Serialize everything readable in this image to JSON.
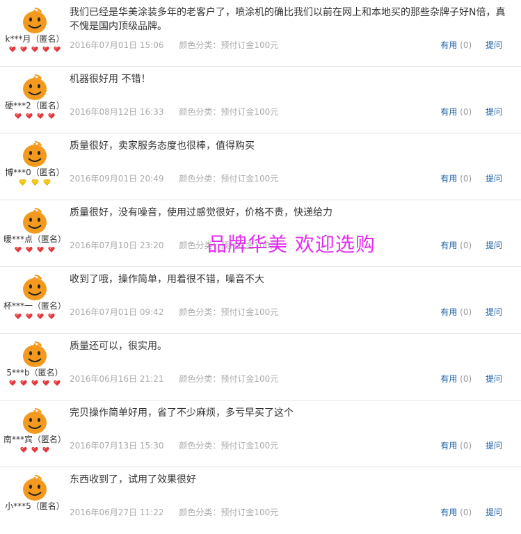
{
  "reviews": [
    {
      "user": "k***月（匿名）",
      "rank_icon": "red-heart",
      "rank_count": 5,
      "content": "我们已经是华美涂装多年的老客户了，喷涂机的确比我们以前在网上和本地买的那些杂牌子好N倍，真不愧是国内顶级品牌。",
      "date": "2016年07月01日 15:06",
      "spec": "颜色分类：预付订金100元",
      "useful_label": "有用",
      "useful_count": "(0)",
      "ask_label": "提问"
    },
    {
      "user": "硬***2（匿名）",
      "rank_icon": "red-heart",
      "rank_count": 4,
      "content": "机器很好用 不错！",
      "date": "2016年08月12日 16:33",
      "spec": "颜色分类：预付订金100元",
      "useful_label": "有用",
      "useful_count": "(0)",
      "ask_label": "提问"
    },
    {
      "user": "博***0（匿名）",
      "rank_icon": "yellow-diamond",
      "rank_count": 3,
      "content": "质量很好，卖家服务态度也很棒，值得购买",
      "date": "2016年09月01日 20:49",
      "spec": "颜色分类：预付订金100元",
      "useful_label": "有用",
      "useful_count": "(0)",
      "ask_label": "提问"
    },
    {
      "user": "暖***点（匿名）",
      "rank_icon": "red-heart",
      "rank_count": 4,
      "content": "质量很好，没有噪音，使用过感觉很好，价格不贵，快递给力",
      "date": "2016年07月10日 23:20",
      "spec": "颜色分类：预付订金100元",
      "useful_label": "有用",
      "useful_count": "(0)",
      "ask_label": "提问"
    },
    {
      "user": "杯***一（匿名）",
      "rank_icon": "red-heart",
      "rank_count": 4,
      "content": "收到了哦，操作简单，用着很不错，噪音不大",
      "date": "2016年07月01日 09:42",
      "spec": "颜色分类：预付订金100元",
      "useful_label": "有用",
      "useful_count": "(0)",
      "ask_label": "提问"
    },
    {
      "user": "5***b（匿名）",
      "rank_icon": "red-heart",
      "rank_count": 5,
      "content": "质量还可以，很实用。",
      "date": "2016年06月16日 21:21",
      "spec": "颜色分类：预付订金100元",
      "useful_label": "有用",
      "useful_count": "(0)",
      "ask_label": "提问"
    },
    {
      "user": "南***宾（匿名）",
      "rank_icon": "red-heart",
      "rank_count": 3,
      "content": "完贝操作简单好用，省了不少麻烦，多亏早买了这个",
      "date": "2016年07月13日 15:30",
      "spec": "颜色分类：预付订金100元",
      "useful_label": "有用",
      "useful_count": "(0)",
      "ask_label": "提问"
    },
    {
      "user": "小***5（匿名）",
      "rank_icon": "red-heart",
      "rank_count": 0,
      "content": "东西收到了，试用了效果很好",
      "date": "2016年06月27日 11:22",
      "spec": "颜色分类：预付订金100元",
      "useful_label": "有用",
      "useful_count": "(0)",
      "ask_label": "提问"
    }
  ],
  "watermark": "品牌华美 欢迎选购",
  "colors": {
    "link": "#1c5ea5",
    "meta": "#aaaaaa",
    "watermark": "#e32cf0",
    "avatar": "#f39a1e",
    "heart": "#e4393c",
    "diamond": "#f5c400"
  }
}
